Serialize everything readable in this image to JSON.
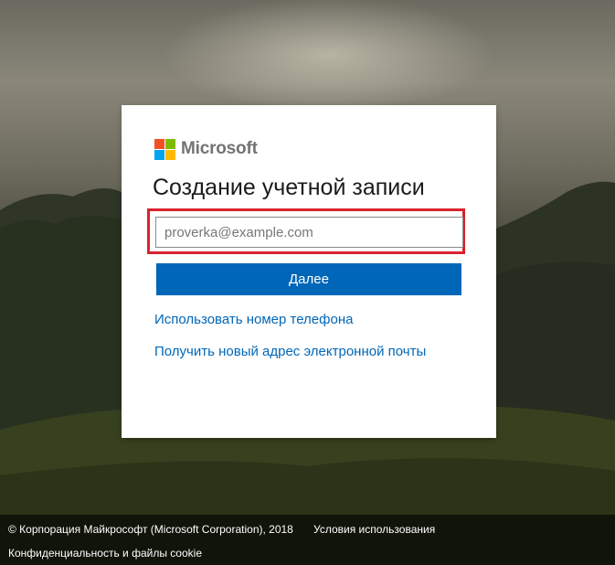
{
  "brand": {
    "name": "Microsoft",
    "logo_colors": [
      "#f25022",
      "#7fba00",
      "#00a4ef",
      "#ffb900"
    ]
  },
  "form": {
    "title": "Создание учетной записи",
    "email_value": "",
    "email_placeholder": "proverka@example.com",
    "next_label": "Далее",
    "use_phone_label": "Использовать номер телефона",
    "new_email_label": "Получить новый адрес электронной почты"
  },
  "footer": {
    "copyright": "© Корпорация Майкрософт (Microsoft Corporation), 2018",
    "terms_label": "Условия использования",
    "privacy_label": "Конфиденциальность и файлы cookie"
  },
  "colors": {
    "accent": "#0067b8",
    "highlight_border": "#d9232e"
  }
}
